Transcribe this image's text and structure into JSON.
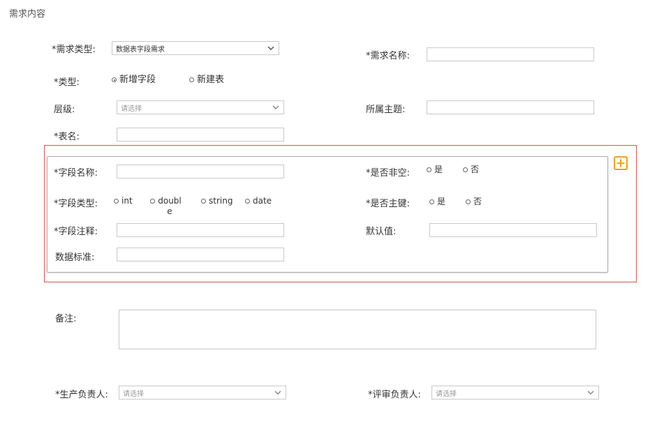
{
  "section_title": "需求内容",
  "req_type": {
    "label": "*需求类型:",
    "value": "数据表字段需求"
  },
  "req_name": {
    "label": "*需求名称:",
    "value": ""
  },
  "type": {
    "label": "*类型:",
    "options": [
      "新增字段",
      "新建表"
    ],
    "selected": "新增字段"
  },
  "level": {
    "label": "层级:",
    "placeholder": "请选择"
  },
  "subject": {
    "label": "所属主题:",
    "value": ""
  },
  "table_name": {
    "label": "*表名:",
    "value": ""
  },
  "field_block": {
    "field_name": {
      "label": "*字段名称:",
      "value": ""
    },
    "not_null": {
      "label": "*是否非空:",
      "options": [
        "是",
        "否"
      ]
    },
    "field_type": {
      "label": "*字段类型:",
      "options": [
        "int",
        "double",
        "string",
        "date"
      ]
    },
    "primary_key": {
      "label": "*是否主键:",
      "options": [
        "是",
        "否"
      ]
    },
    "comment": {
      "label": "*字段注释:",
      "value": ""
    },
    "default_value": {
      "label": "默认值:",
      "value": ""
    },
    "data_standard": {
      "label": "数据标准:",
      "value": ""
    }
  },
  "remark": {
    "label": "备注:",
    "value": ""
  },
  "producer": {
    "label": "*生产负责人:",
    "placeholder": "请选择"
  },
  "reviewer": {
    "label": "*评审负责人:",
    "placeholder": "请选择"
  },
  "colors": {
    "border_red": "#d9534f",
    "add_orange": "#f0a020",
    "input_border": "#c9c9c9"
  }
}
